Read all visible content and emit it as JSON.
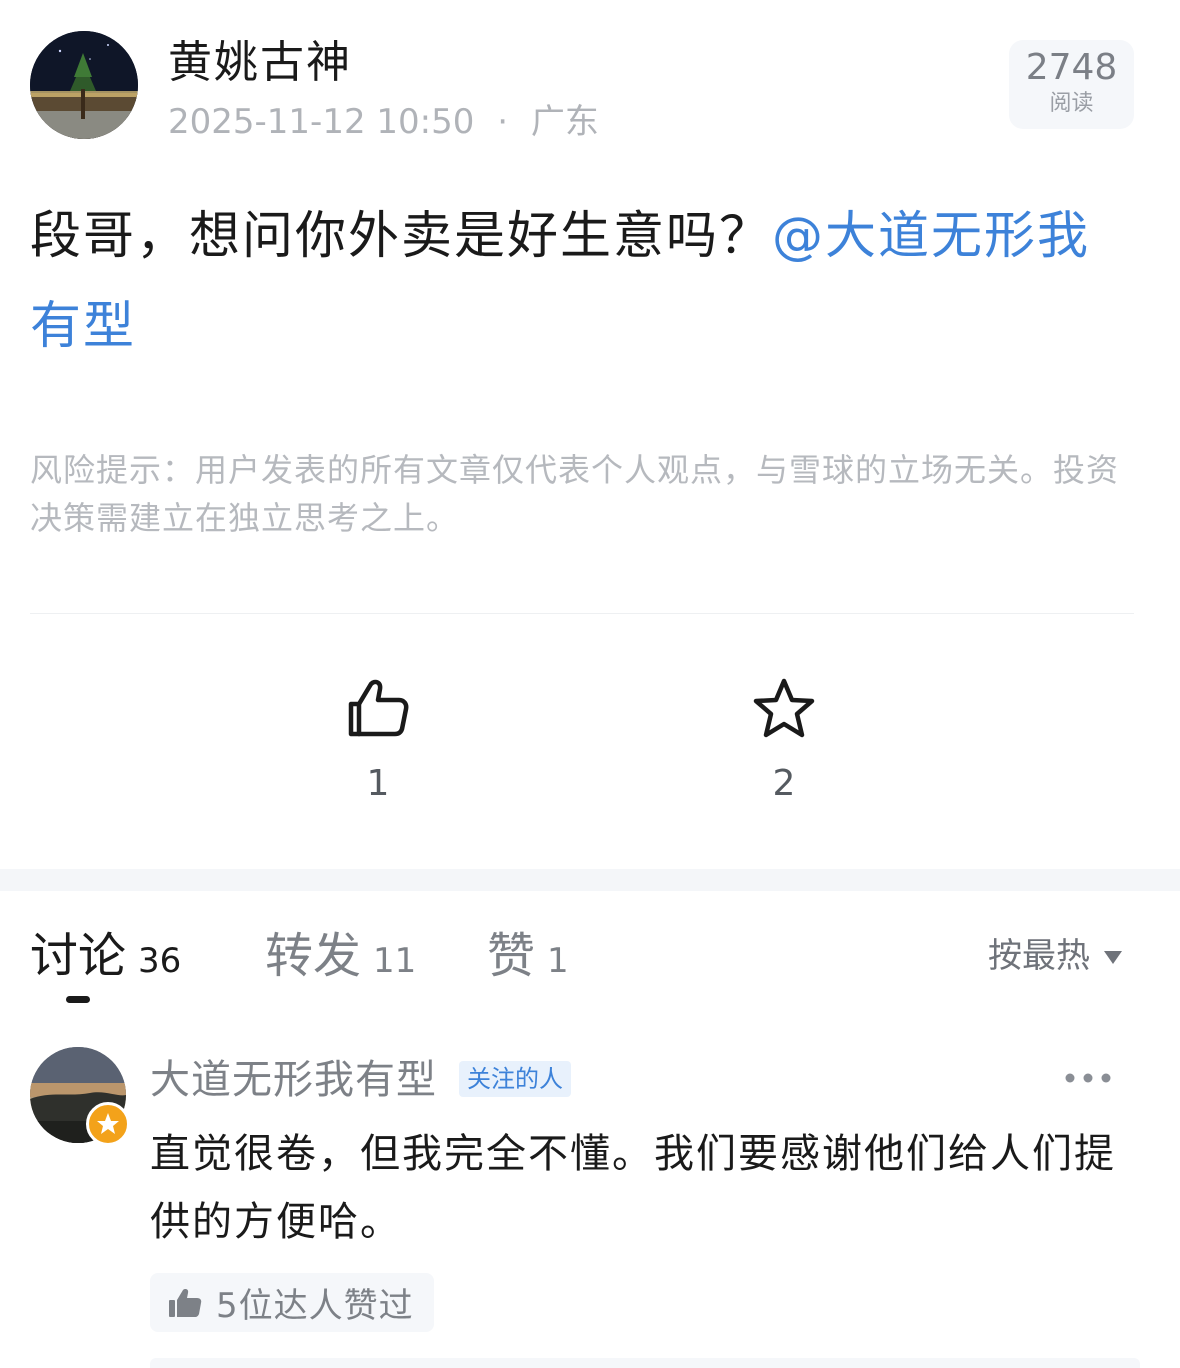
{
  "post": {
    "author": "黄姚古神",
    "timestamp": "2025-11-12 10:50",
    "separator": "·",
    "location": "广东",
    "read_count": "2748",
    "read_label": "阅读",
    "text": "段哥，想问你外卖是好生意吗？",
    "mention": "@大道无形我有型",
    "risk_notice": "风险提示：用户发表的所有文章仅代表个人观点，与雪球的立场无关。投资决策需建立在独立思考之上。"
  },
  "actions": {
    "like_count": "1",
    "favorite_count": "2",
    "like_icon": "thumbs-up-icon",
    "favorite_icon": "star-icon"
  },
  "tabs": [
    {
      "label": "讨论",
      "count": "36",
      "active": true
    },
    {
      "label": "转发",
      "count": "11",
      "active": false
    },
    {
      "label": "赞",
      "count": "1",
      "active": false
    }
  ],
  "sort": {
    "label": "按最热"
  },
  "comment": {
    "author": "大道无形我有型",
    "tag": "关注的人",
    "text": "直觉很卷，但我完全不懂。我们要感谢他们给人们提供的方便哈。",
    "likers_text": "5位达人赞过"
  },
  "colors": {
    "accent": "#3d82d9",
    "muted": "#b0b3b8",
    "badge": "#f3a21a"
  }
}
